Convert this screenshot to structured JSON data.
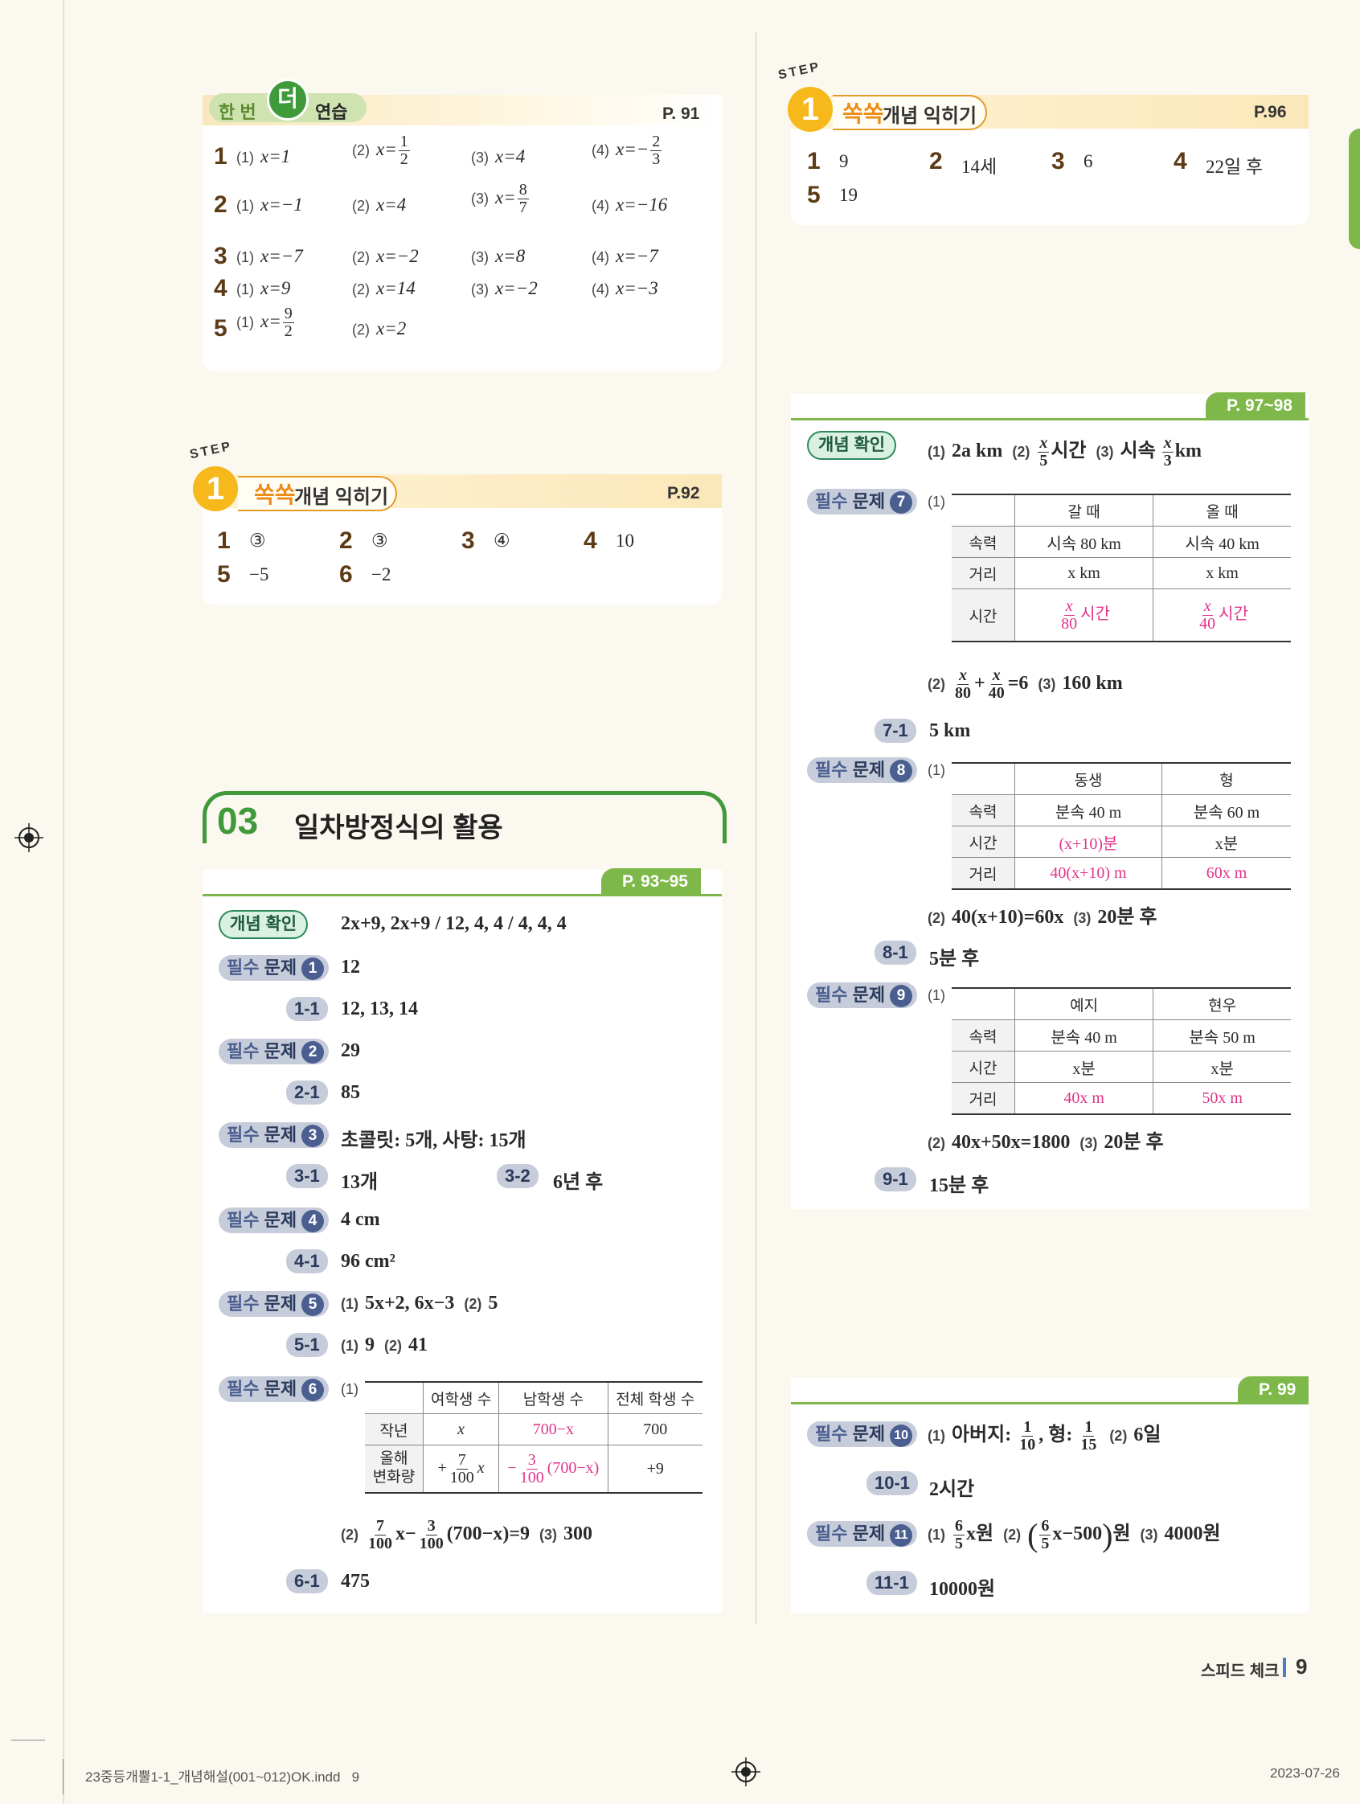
{
  "hanbeon": {
    "badge_left": "한 번",
    "badge_mid": "더",
    "badge_right": "연습",
    "page": "P. 91",
    "rows": [
      {
        "num": "1",
        "items": [
          {
            "sub": "(1)",
            "text": "x=1"
          },
          {
            "sub": "(2)",
            "pre": "x=",
            "fn": "1",
            "fd": "2"
          },
          {
            "sub": "(3)",
            "text": "x=4"
          },
          {
            "sub": "(4)",
            "pre": "x=−",
            "fn": "2",
            "fd": "3"
          }
        ]
      },
      {
        "num": "2",
        "items": [
          {
            "sub": "(1)",
            "text": "x=−1"
          },
          {
            "sub": "(2)",
            "text": "x=4"
          },
          {
            "sub": "(3)",
            "pre": "x=",
            "fn": "8",
            "fd": "7"
          },
          {
            "sub": "(4)",
            "text": "x=−16"
          }
        ]
      },
      {
        "num": "3",
        "items": [
          {
            "sub": "(1)",
            "text": "x=−7"
          },
          {
            "sub": "(2)",
            "text": "x=−2"
          },
          {
            "sub": "(3)",
            "text": "x=8"
          },
          {
            "sub": "(4)",
            "text": "x=−7"
          }
        ]
      },
      {
        "num": "4",
        "items": [
          {
            "sub": "(1)",
            "text": "x=9"
          },
          {
            "sub": "(2)",
            "text": "x=14"
          },
          {
            "sub": "(3)",
            "text": "x=−2"
          },
          {
            "sub": "(4)",
            "text": "x=−3"
          }
        ]
      },
      {
        "num": "5",
        "items": [
          {
            "sub": "(1)",
            "pre": "x=",
            "fn": "9",
            "fd": "2"
          },
          {
            "sub": "(2)",
            "text": "x=2"
          }
        ]
      }
    ]
  },
  "step_p92": {
    "step_word": "STEP",
    "step_num": "1",
    "ssuk": "쏙쏙",
    "title": "개념 익히기",
    "page": "P.92",
    "answers": [
      {
        "num": "1",
        "val": "③"
      },
      {
        "num": "2",
        "val": "③"
      },
      {
        "num": "3",
        "val": "④"
      },
      {
        "num": "4",
        "val": "10"
      },
      {
        "num": "5",
        "val": "−5"
      },
      {
        "num": "6",
        "val": "−2"
      }
    ]
  },
  "section": {
    "number": "03",
    "title": "일차방정식의 활용",
    "page": "P. 93~95"
  },
  "left_items": {
    "gainyeom_label": "개념 확인",
    "gainyeom_text": "2x+9, 2x+9 / 12, 4, 4 / 4, 4, 4",
    "pilsu_prefix": "필수",
    "pilsu_word": "문제",
    "p1": {
      "n": "1",
      "text": "12"
    },
    "s11": {
      "label": "1-1",
      "text": "12, 13, 14"
    },
    "p2": {
      "n": "2",
      "text": "29"
    },
    "s21": {
      "label": "2-1",
      "text": "85"
    },
    "p3": {
      "n": "3",
      "text": "초콜릿: 5개, 사탕: 15개"
    },
    "s31": {
      "label": "3-1",
      "text": "13개"
    },
    "s32": {
      "label": "3-2",
      "text": "6년 후"
    },
    "p4": {
      "n": "4",
      "text": "4 cm"
    },
    "s41": {
      "label": "4-1",
      "text": "96 cm²"
    },
    "p5": {
      "n": "5",
      "text1": "(1)",
      "text2": "5x+2, 6x−3",
      "text3": "(2)",
      "text4": "5"
    },
    "s51": {
      "label": "5-1",
      "t1": "(1)",
      "t2": "9",
      "t3": "(2)",
      "t4": "41"
    },
    "p6": {
      "n": "6",
      "sub": "(1)"
    },
    "p6_table": {
      "headers": [
        "여학생 수",
        "남학생 수",
        "전체 학생 수"
      ],
      "row1_label": "작년",
      "row1": [
        "x",
        "700−x",
        "700"
      ],
      "row2_label_a": "올해",
      "row2_label_b": "변화량",
      "row2_a_pre": "+",
      "row2_a_fn": "7",
      "row2_a_fd": "100",
      "row2_a_post": "x",
      "row2_b_pre": "−",
      "row2_b_fn": "3",
      "row2_b_fd": "100",
      "row2_b_post": "(700−x)",
      "row2_c": "+9"
    },
    "p6_2": {
      "sub": "(2)",
      "f1n": "7",
      "f1d": "100",
      "mid": "x−",
      "f2n": "3",
      "f2d": "100",
      "tail": "(700−x)=9",
      "sub3": "(3)",
      "ans3": "300"
    },
    "s61": {
      "label": "6-1",
      "text": "475"
    }
  },
  "step_p96": {
    "step_word": "STEP",
    "step_num": "1",
    "ssuk": "쏙쏙",
    "title": "개념 익히기",
    "page": "P.96",
    "answers": [
      {
        "num": "1",
        "val": "9"
      },
      {
        "num": "2",
        "val": "14세"
      },
      {
        "num": "3",
        "val": "6"
      },
      {
        "num": "4",
        "val": "22일 후"
      },
      {
        "num": "5",
        "val": "19"
      }
    ]
  },
  "right_a": {
    "page": "P. 97~98",
    "gainyeom_label": "개념 확인",
    "g1": "(1)",
    "g1v": "2a km",
    "g2": "(2)",
    "g2fn": "x",
    "g2fd": "5",
    "g2t": "시간",
    "g3": "(3)",
    "g3pre": "시속",
    "g3fn": "x",
    "g3fd": "3",
    "g3t": "km",
    "p7": {
      "n": "7",
      "sub": "(1)"
    },
    "t7": {
      "headers": [
        "갈 때",
        "올 때"
      ],
      "rows": [
        {
          "label": "속력",
          "a": "시속 80 km",
          "b": "시속 40 km"
        },
        {
          "label": "거리",
          "a": "x km",
          "b": "x km"
        },
        {
          "label": "시간",
          "afn": "x",
          "afd": "80",
          "at": "시간",
          "bfn": "x",
          "bfd": "40",
          "bt": "시간"
        }
      ]
    },
    "p7_2": {
      "sub": "(2)",
      "f1n": "x",
      "f1d": "80",
      "plus": "+",
      "f2n": "x",
      "f2d": "40",
      "tail": "=6",
      "sub3": "(3)",
      "ans3": "160 km"
    },
    "s71": {
      "label": "7-1",
      "text": "5 km"
    },
    "p8": {
      "n": "8",
      "sub": "(1)"
    },
    "t8": {
      "headers": [
        "동생",
        "형"
      ],
      "rows": [
        {
          "label": "속력",
          "a": "분속 40 m",
          "b": "분속 60 m"
        },
        {
          "label": "시간",
          "a": "(x+10)분",
          "b": "x분"
        },
        {
          "label": "거리",
          "a": "40(x+10) m",
          "b": "60x m"
        }
      ]
    },
    "p8_2": {
      "sub": "(2)",
      "eq": "40(x+10)=60x",
      "sub3": "(3)",
      "ans3": "20분 후"
    },
    "s81": {
      "label": "8-1",
      "text": "5분 후"
    },
    "p9": {
      "n": "9",
      "sub": "(1)"
    },
    "t9": {
      "headers": [
        "예지",
        "현우"
      ],
      "rows": [
        {
          "label": "속력",
          "a": "분속 40 m",
          "b": "분속 50 m"
        },
        {
          "label": "시간",
          "a": "x분",
          "b": "x분"
        },
        {
          "label": "거리",
          "a": "40x m",
          "b": "50x m"
        }
      ]
    },
    "p9_2": {
      "sub": "(2)",
      "eq": "40x+50x=1800",
      "sub3": "(3)",
      "ans3": "20분 후"
    },
    "s91": {
      "label": "9-1",
      "text": "15분 후"
    }
  },
  "right_b": {
    "page": "P. 99",
    "p10": {
      "n": "10",
      "sub": "(1)",
      "pre": "아버지:",
      "f1n": "1",
      "f1d": "10",
      "mid": ", 형:",
      "f2n": "1",
      "f2d": "15",
      "sub2": "(2)",
      "ans2": "6일"
    },
    "s101": {
      "label": "10-1",
      "text": "2시간"
    },
    "p11": {
      "n": "11",
      "sub": "(1)",
      "f1n": "6",
      "f1d": "5",
      "t1": "x원",
      "sub2": "(2)",
      "lp": "(",
      "f2n": "6",
      "f2d": "5",
      "t2": "x−500",
      "rp": ")",
      "t2b": "원",
      "sub3": "(3)",
      "ans3": "4000원"
    },
    "s111": {
      "label": "11-1",
      "text": "10000원"
    }
  },
  "footer": {
    "speed_check": "스피드 체크",
    "page_num": "9",
    "file": "23중등개뿔1-1_개념해설(001~012)OK.indd   9",
    "date": "2023-07-26"
  },
  "colors": {
    "green": "#7fb84a",
    "orange": "#f6b81a",
    "navy": "#4a5f8f",
    "pink": "#e0338a"
  }
}
